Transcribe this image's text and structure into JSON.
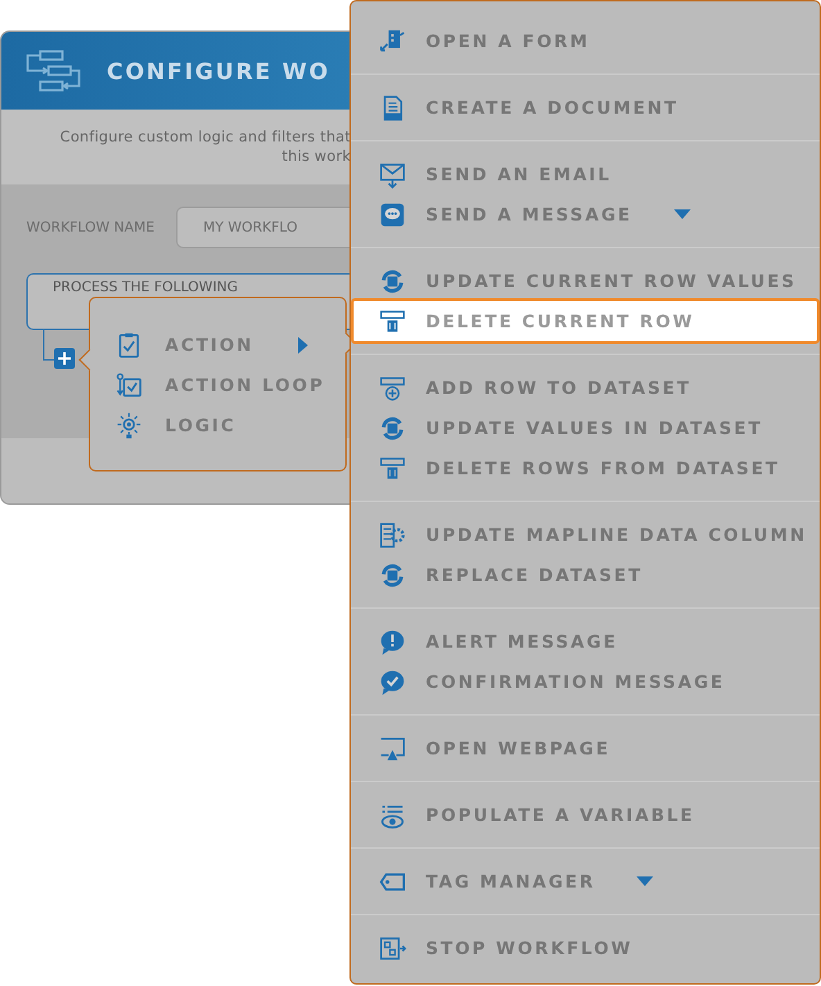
{
  "panel": {
    "title": "CONFIGURE WO",
    "description": [
      "Configure custom logic and filters that",
      "this work"
    ],
    "name_label": "WORKFLOW NAME",
    "name_value": "MY WORKFLO",
    "process_label": "PROCESS THE FOLLOWING"
  },
  "submenu": {
    "items": [
      {
        "label": "ACTION",
        "has_submenu": true
      },
      {
        "label": "ACTION LOOP",
        "has_submenu": false
      },
      {
        "label": "LOGIC",
        "has_submenu": false
      }
    ]
  },
  "menu": {
    "groups": [
      {
        "items": [
          {
            "label": "OPEN A FORM",
            "selected": false,
            "dropdown": false
          }
        ]
      },
      {
        "items": [
          {
            "label": "CREATE A DOCUMENT",
            "selected": false,
            "dropdown": false
          }
        ]
      },
      {
        "items": [
          {
            "label": "SEND AN EMAIL",
            "selected": false,
            "dropdown": false
          },
          {
            "label": "SEND A MESSAGE",
            "selected": false,
            "dropdown": true
          }
        ]
      },
      {
        "items": [
          {
            "label": "UPDATE CURRENT ROW VALUES",
            "selected": false,
            "dropdown": false
          },
          {
            "label": "DELETE CURRENT ROW",
            "selected": true,
            "dropdown": false
          }
        ]
      },
      {
        "items": [
          {
            "label": "ADD ROW TO DATASET",
            "selected": false,
            "dropdown": false
          },
          {
            "label": "UPDATE VALUES IN DATASET",
            "selected": false,
            "dropdown": false
          },
          {
            "label": "DELETE ROWS FROM DATASET",
            "selected": false,
            "dropdown": false
          }
        ]
      },
      {
        "items": [
          {
            "label": "UPDATE MAPLINE DATA COLUMN",
            "selected": false,
            "dropdown": false
          },
          {
            "label": "REPLACE DATASET",
            "selected": false,
            "dropdown": false
          }
        ]
      },
      {
        "items": [
          {
            "label": "ALERT MESSAGE",
            "selected": false,
            "dropdown": false
          },
          {
            "label": "CONFIRMATION MESSAGE",
            "selected": false,
            "dropdown": false
          }
        ]
      },
      {
        "items": [
          {
            "label": "OPEN WEBPAGE",
            "selected": false,
            "dropdown": false
          }
        ]
      },
      {
        "items": [
          {
            "label": "POPULATE A VARIABLE",
            "selected": false,
            "dropdown": false
          }
        ]
      },
      {
        "items": [
          {
            "label": "TAG MANAGER",
            "selected": false,
            "dropdown": true
          }
        ]
      },
      {
        "items": [
          {
            "label": "STOP WORKFLOW",
            "selected": false,
            "dropdown": false
          }
        ]
      }
    ]
  }
}
